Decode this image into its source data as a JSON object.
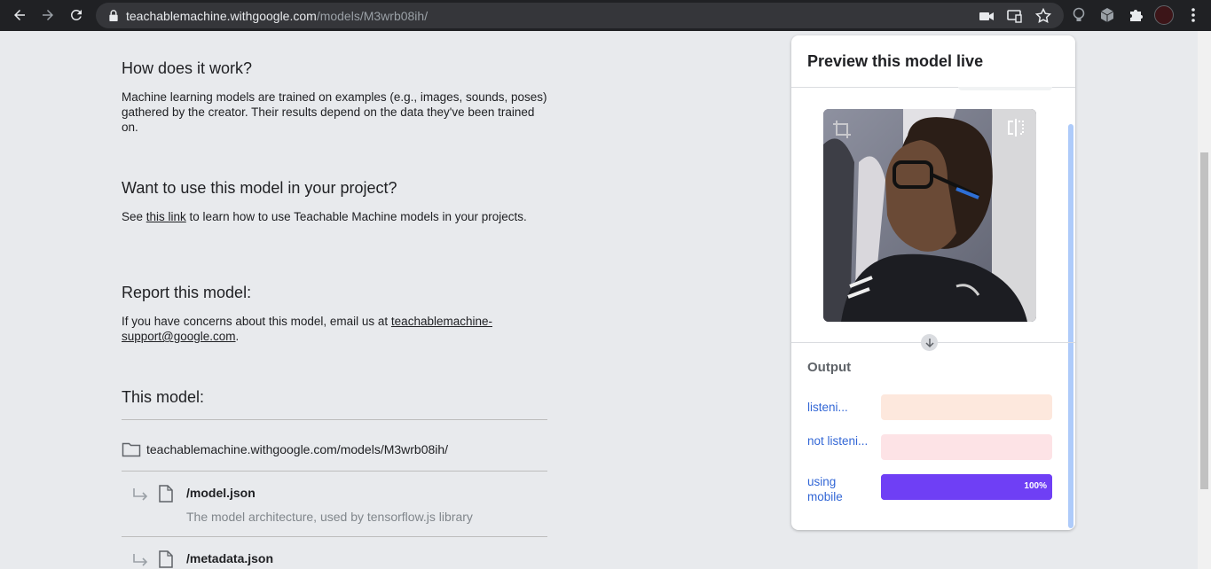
{
  "browser": {
    "url_host": "teachablemachine.withgoogle.com",
    "url_path": "/models/M3wrb08ih/",
    "icons": [
      "back-icon",
      "forward-icon",
      "reload-icon",
      "lock-icon",
      "camera-icon",
      "cast-icon",
      "bookmark-star-icon",
      "extension-bulb-icon",
      "extension-cube-icon",
      "puzzle-icon",
      "profile-avatar",
      "menu-dots-icon"
    ]
  },
  "sections": {
    "how": {
      "title": "How does it work?",
      "body": "Machine learning models are trained on examples (e.g., images, sounds, poses) gathered by the creator. Their results depend on the data they've been trained on."
    },
    "use": {
      "title": "Want to use this model in your project?",
      "before_link": "See ",
      "link": "this link",
      "after_link": " to learn how to use Teachable Machine models in your projects."
    },
    "report": {
      "title": "Report this model:",
      "before_link": "If you have concerns about this model, email us at ",
      "link": "teachablemachine-support@google.com",
      "after_link": "."
    },
    "model": {
      "title": "This model:",
      "folder": "teachablemachine.withgoogle.com/models/M3wrb08ih/",
      "files": [
        {
          "name": "/model.json",
          "desc": "The model architecture, used by tensorflow.js library"
        },
        {
          "name": "/metadata.json",
          "desc": ""
        }
      ]
    }
  },
  "preview": {
    "title": "Preview this model live",
    "output_label": "Output",
    "classes": [
      {
        "name": "listeni...",
        "value": 0,
        "color": "#fde8dd"
      },
      {
        "name": "not listeni...",
        "value": 0,
        "color": "#fde3e6"
      },
      {
        "name": "using mobile",
        "value": 1.0,
        "pct_label": "100%",
        "color": "#6f3ff5"
      }
    ]
  }
}
